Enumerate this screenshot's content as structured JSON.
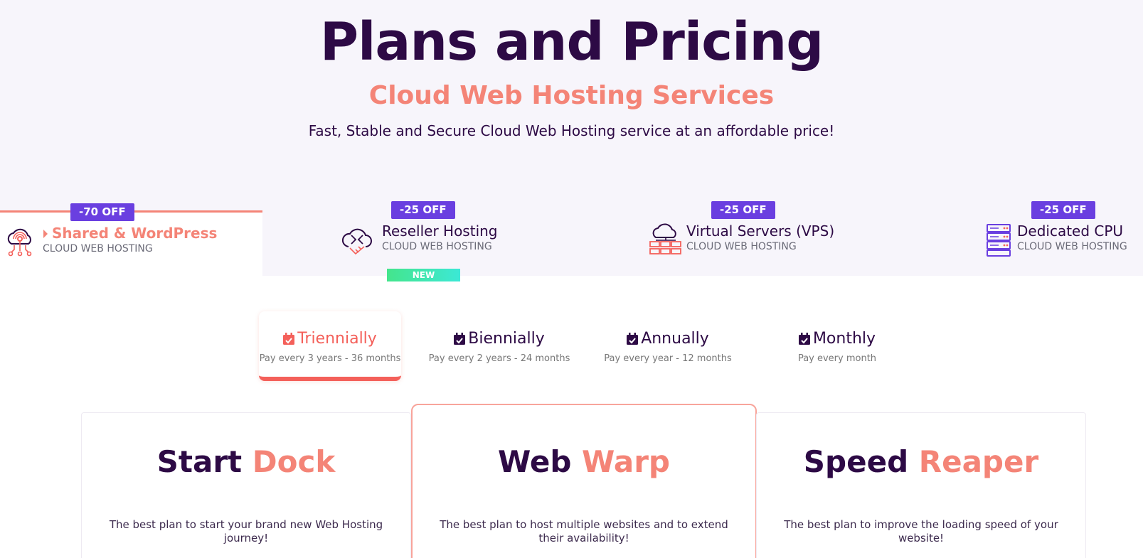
{
  "hero": {
    "title": "Plans and Pricing",
    "subtitle": "Cloud Web Hosting Services",
    "description": "Fast, Stable and Secure Cloud Web Hosting service at an affordable price!"
  },
  "services": [
    {
      "name": "Shared & WordPress",
      "type": "CLOUD WEB HOSTING",
      "badge": "-70 OFF",
      "icon": "cloud-network-icon",
      "active": true
    },
    {
      "name": "Reseller Hosting",
      "type": "CLOUD WEB HOSTING",
      "badge": "-25 OFF",
      "icon": "cloud-handshake-icon",
      "tag": "NEW"
    },
    {
      "name": "Virtual Servers (VPS)",
      "type": "CLOUD WEB HOSTING",
      "badge": "-25 OFF",
      "icon": "cloud-servers-icon"
    },
    {
      "name": "Dedicated CPU",
      "type": "CLOUD WEB HOSTING",
      "badge": "-25 OFF",
      "icon": "server-rack-icon"
    }
  ],
  "periods": [
    {
      "label": "Triennially",
      "desc": "Pay every 3 years - 36 months",
      "active": true
    },
    {
      "label": "Biennially",
      "desc": "Pay every 2 years - 24 months"
    },
    {
      "label": "Annually",
      "desc": "Pay every year - 12 months"
    },
    {
      "label": "Monthly",
      "desc": "Pay every month"
    }
  ],
  "plans": [
    {
      "name_main": "Start",
      "name_accent": "Dock",
      "desc": "The best plan to start your brand new Web Hosting journey!"
    },
    {
      "name_main": "Web",
      "name_accent": "Warp",
      "desc": "The best plan to host multiple websites and to extend their availability!",
      "featured": true
    },
    {
      "name_main": "Speed",
      "name_accent": "Reaper",
      "desc": "The best plan to improve the loading speed of your website!"
    }
  ],
  "colors": {
    "primary": "#2d0a45",
    "accent": "#f48477",
    "badge": "#6a3fe0",
    "active_tab": "#f4605a"
  }
}
